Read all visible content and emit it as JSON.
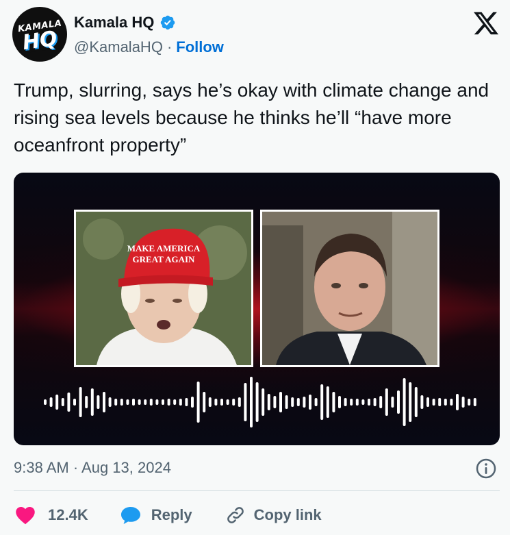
{
  "author": {
    "display_name": "Kamala HQ",
    "handle": "@KamalaHQ",
    "separator": "·",
    "follow_label": "Follow",
    "avatar_top": "KAMALA",
    "avatar_bottom": "HQ"
  },
  "tweet": {
    "text": "Trump, slurring, says he’s okay with climate change and rising sea levels because he thinks he’ll “have more oceanfront property”",
    "timestamp": "9:38 AM · Aug 13, 2024"
  },
  "media": {
    "left_photo": {
      "cap_text_line1": "MAKE AMERICA",
      "cap_text_line2": "GREAT AGAIN"
    }
  },
  "actions": {
    "like_count": "12.4K",
    "reply_label": "Reply",
    "copy_label": "Copy link"
  },
  "colors": {
    "follow_blue": "#006fd6",
    "verified_blue": "#1d9bf0",
    "like_pink": "#f91880",
    "secondary_text": "#536471"
  },
  "icons": [
    "verified-badge-icon",
    "x-logo-icon",
    "info-icon",
    "heart-icon",
    "reply-bubble-icon",
    "link-icon"
  ]
}
